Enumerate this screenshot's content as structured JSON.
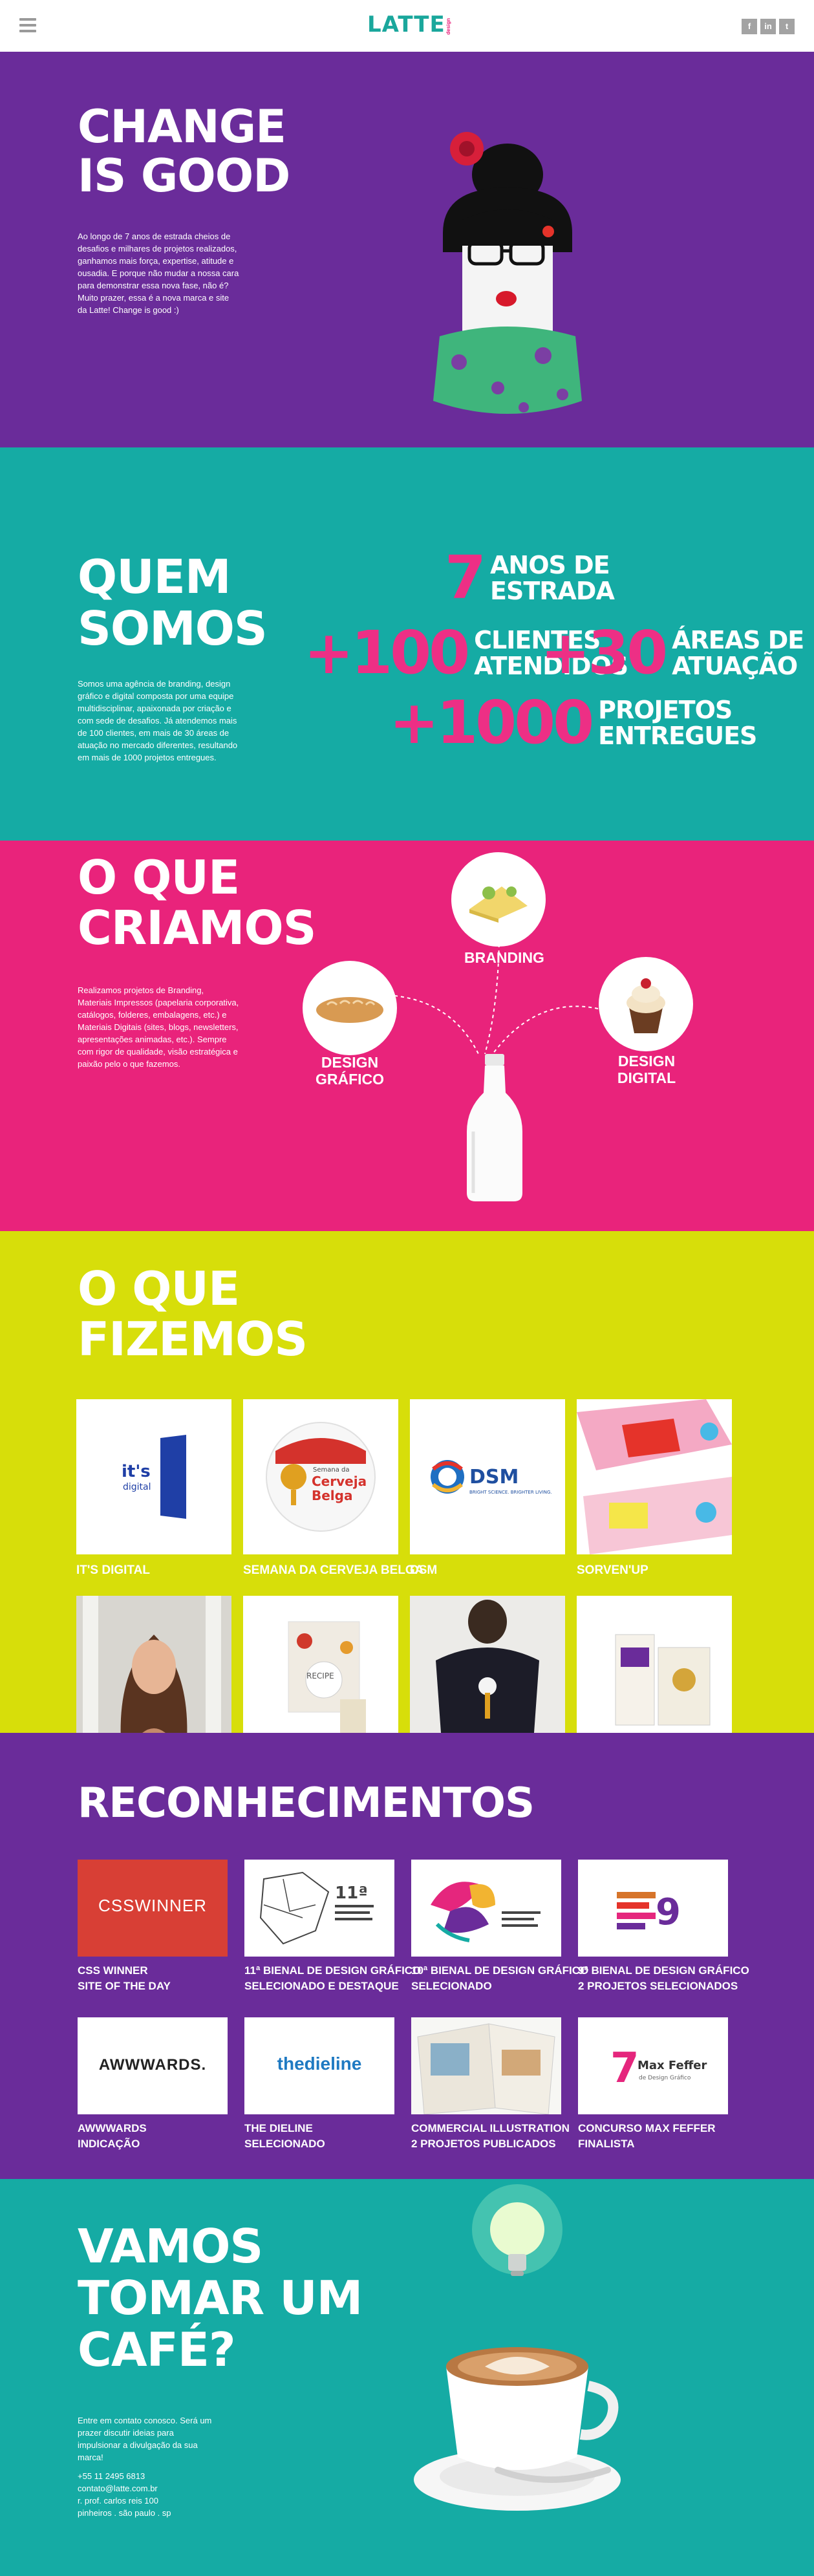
{
  "header": {
    "logo": "LATTE",
    "logo_sub": "design",
    "social": [
      "f",
      "in",
      "t"
    ]
  },
  "hero": {
    "title_line1": "CHANGE",
    "title_line2": "IS GOOD",
    "text": "Ao longo de 7 anos de estrada cheios de desafios e milhares de projetos realizados, ganhamos mais força, expertise, atitude e ousadia. E porque não mudar a nossa cara para demonstrar essa nova fase, não é? Muito prazer, essa é a nova marca e site da Latte! Change is good :)"
  },
  "quem": {
    "title_line1": "QUEM",
    "title_line2": "SOMOS",
    "text": "Somos uma agência de branding, design gráfico e digital composta por uma equipe multidisciplinar, apaixonada por criação e com  sede de desafios. Já atendemos mais de 100 clientes, em mais de 30 áreas de atuação no mercado diferentes, resultando em mais de 1000 projetos entregues.",
    "stats": [
      {
        "num": "7",
        "label1": "ANOS DE",
        "label2": "ESTRADA"
      },
      {
        "num": "+100",
        "label1": "CLIENTES",
        "label2": "ATENDIDOS"
      },
      {
        "num": "+30",
        "label1": "ÁREAS DE",
        "label2": "ATUAÇÃO"
      },
      {
        "num": "+1000",
        "label1": "PROJETOS",
        "label2": "ENTREGUES"
      }
    ]
  },
  "criamos": {
    "title_line1": "O QUE",
    "title_line2": "CRIAMOS",
    "text": "Realizamos projetos de Branding, Materiais Impressos (papelaria corporativa, catálogos, folderes, embalagens, etc.) e Materiais Digitais (sites, blogs, newsletters, apresentações animadas, etc.). Sempre com rigor de qualidade, visão estratégica e paixão pelo o que fazemos.",
    "branding": "BRANDING",
    "design_grafico_1": "DESIGN",
    "design_grafico_2": "GRÁFICO",
    "design_digital": "DESIGN DIGITAL"
  },
  "fazemos": {
    "title_line1": "O QUE",
    "title_line2": "FIZEMOS",
    "projects": [
      {
        "label": "IT'S DIGITAL"
      },
      {
        "label": "SEMANA DA CERVEJA BELGA"
      },
      {
        "label": "DSM"
      },
      {
        "label": "SORVEN'UP"
      }
    ],
    "tile_texts": {
      "its": "it's",
      "digital": "digital",
      "cerveja_top": "Semana da",
      "cerveja_mid": "Cerveja",
      "cerveja_bot": "Belga",
      "dsm": "DSM",
      "dsm_sub": "BRIGHT SCIENCE. BRIGHTER LIVING.",
      "recipe": "RECIPE"
    }
  },
  "recon": {
    "title": "RECONHECIMENTOS",
    "awards": [
      {
        "line1": "CSS WINNER",
        "line2": "SITE OF THE DAY"
      },
      {
        "line1": "11ª BIENAL DE DESIGN GRÁFICO",
        "line2": "SELECIONADO E DESTAQUE"
      },
      {
        "line1": "10ª BIENAL DE DESIGN GRÁFICO",
        "line2": "SELECIONADO"
      },
      {
        "line1": "9ª BIENAL DE DESIGN GRÁFICO",
        "line2": "2 PROJETOS SELECIONADOS"
      },
      {
        "line1": "AWWWARDS",
        "line2": "INDICAÇÃO"
      },
      {
        "line1": "THE DIELINE",
        "line2": "SELECIONADO"
      },
      {
        "line1": "COMMERCIAL ILLUSTRATION",
        "line2": "2 PROJETOS PUBLICADOS"
      },
      {
        "line1": "CONCURSO MAX FEFFER",
        "line2": "FINALISTA"
      }
    ],
    "logos": {
      "csswinner": "CSSWINNER",
      "bienal11": "11ª",
      "awwwards": "AWWWARDS.",
      "dieline": "thedieline",
      "max_feffer": "Max Feffer",
      "max_sub": "de Design Gráfico",
      "nine": "9",
      "seven": "7"
    }
  },
  "cafe": {
    "title_line1": "VAMOS",
    "title_line2": "TOMAR UM",
    "title_line3": "CAFÉ?",
    "text": "Entre em contato conosco. Será um prazer discutir ideias para impulsionar a divulgação da sua marca!",
    "phone": "+55 11 2495 6813",
    "email": "contato@latte.com.br",
    "address1": "r. prof. carlos reis 100",
    "address2": "pinheiros . são paulo . sp"
  },
  "colors": {
    "purple": "#6a2c9a",
    "teal": "#15aba4",
    "pink": "#e9237b",
    "lime": "#d7de0a"
  }
}
